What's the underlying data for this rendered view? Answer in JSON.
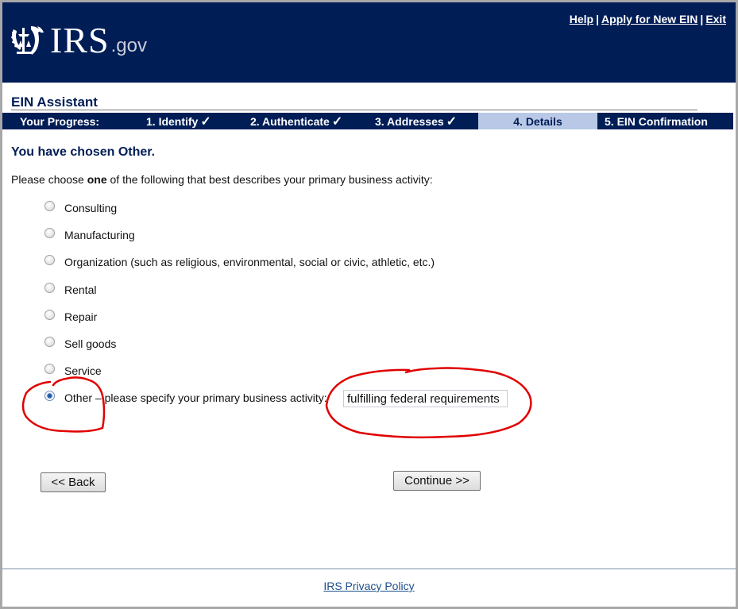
{
  "header": {
    "logo_text": "IRS",
    "logo_suffix": ".gov",
    "links": [
      {
        "label": "Help"
      },
      {
        "label": "Apply for New EIN"
      },
      {
        "label": "Exit"
      }
    ],
    "separator": "|"
  },
  "app_title": "EIN Assistant",
  "progress": {
    "label": "Your Progress:",
    "steps": [
      {
        "label": "1. Identify",
        "completed": true,
        "check": "✓"
      },
      {
        "label": "2. Authenticate",
        "completed": true,
        "check": "✓"
      },
      {
        "label": "3. Addresses",
        "completed": true,
        "check": "✓"
      },
      {
        "label": "4. Details",
        "active": true
      },
      {
        "label": "5. EIN Confirmation"
      }
    ]
  },
  "main": {
    "heading": "You have chosen Other.",
    "instruction_pre": "Please choose ",
    "instruction_bold": "one",
    "instruction_post": " of the following that best describes your primary business activity:",
    "options": [
      {
        "label": "Consulting",
        "selected": false
      },
      {
        "label": "Manufacturing",
        "selected": false
      },
      {
        "label": "Organization (such as religious, environmental, social or civic, athletic, etc.)",
        "selected": false
      },
      {
        "label": "Rental",
        "selected": false
      },
      {
        "label": "Repair",
        "selected": false
      },
      {
        "label": "Sell goods",
        "selected": false
      },
      {
        "label": "Service",
        "selected": false
      },
      {
        "label": "Other – please specify your primary business activity:",
        "selected": true
      }
    ],
    "specify_value": "fulfilling federal requirements",
    "back_label": "<< Back",
    "continue_label": "Continue >>"
  },
  "footer": {
    "privacy_label": "IRS Privacy Policy"
  },
  "colors": {
    "brand_navy": "#001d56",
    "active_step": "#b8c8e6",
    "annotation_red": "#e00000"
  }
}
